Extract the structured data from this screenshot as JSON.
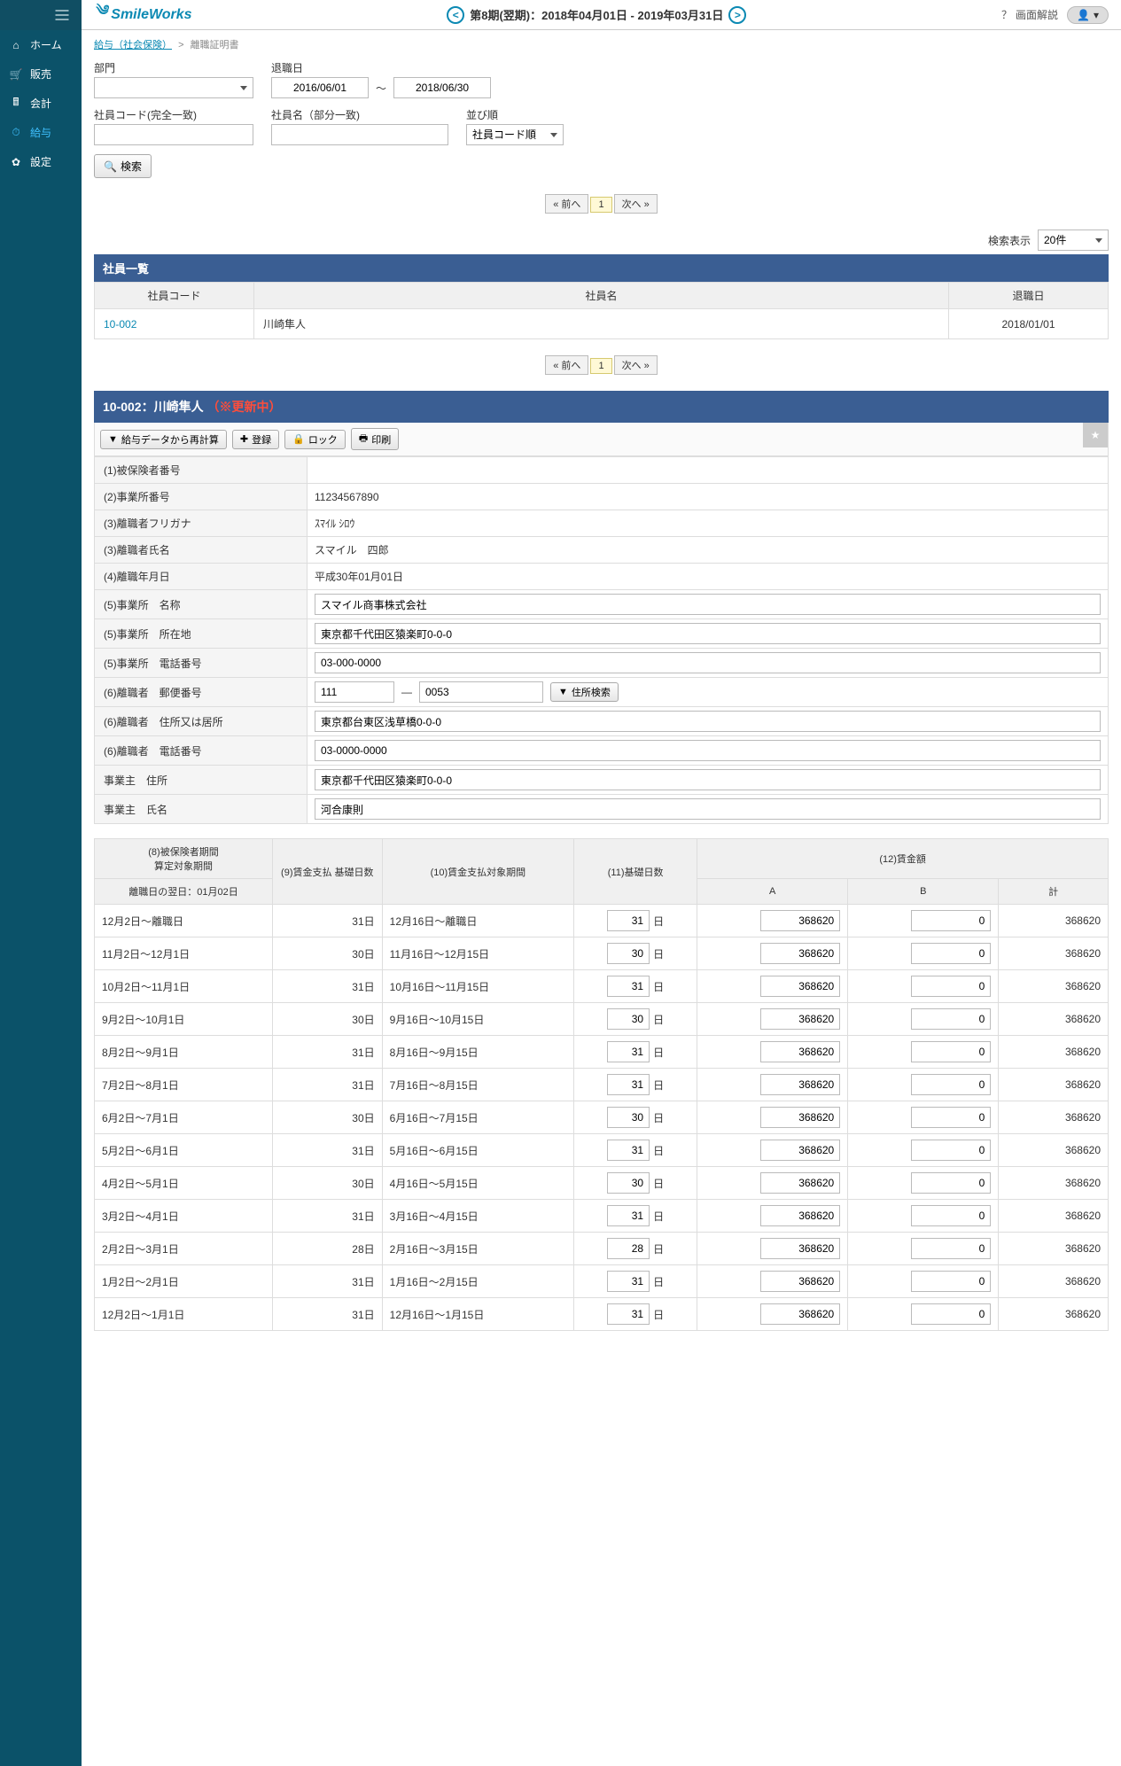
{
  "brand": "SmileWorks",
  "header": {
    "period": "第8期(翌期)：2018年04月01日 - 2019年03月31日",
    "help": "画面解説"
  },
  "sidebar": {
    "items": [
      {
        "label": "ホーム"
      },
      {
        "label": "販売"
      },
      {
        "label": "会計"
      },
      {
        "label": "給与"
      },
      {
        "label": "設定"
      }
    ]
  },
  "breadcrumb": {
    "parent": "給与（社会保険）",
    "current": "離職証明書"
  },
  "search": {
    "dept_label": "部門",
    "leave_label": "退職日",
    "leave_from": "2016/06/01",
    "leave_to": "2018/06/30",
    "tilde": "～",
    "code_label": "社員コード(完全一致)",
    "name_label": "社員名（部分一致)",
    "sort_label": "並び順",
    "sort_value": "社員コード順",
    "search_btn": "検索"
  },
  "pager": {
    "prev": "« 前へ",
    "page": "1",
    "next": "次へ »"
  },
  "results": {
    "display_label": "検索表示",
    "display_value": "20件",
    "title": "社員一覧",
    "cols": {
      "code": "社員コード",
      "name": "社員名",
      "leave": "退職日"
    },
    "rows": [
      {
        "code": "10-002",
        "name": "川崎隼人",
        "leave": "2018/01/01"
      }
    ]
  },
  "detail": {
    "title_id": "10-002：川崎隼人",
    "title_warn": "（※更新中）",
    "btn_recalc": "給与データから再計算",
    "btn_reg": "登録",
    "btn_lock": "ロック",
    "btn_print": "印刷",
    "fields": {
      "f1": {
        "label": "(1)被保険者番号",
        "value": ""
      },
      "f2": {
        "label": "(2)事業所番号",
        "value": "11234567890"
      },
      "f3a": {
        "label": "(3)離職者フリガナ",
        "value": "ｽﾏｲﾙ ｼﾛｳ"
      },
      "f3b": {
        "label": "(3)離職者氏名",
        "value": "スマイル　四郎"
      },
      "f4": {
        "label": "(4)離職年月日",
        "value": "平成30年01月01日"
      },
      "f5a": {
        "label": "(5)事業所　名称",
        "value": "スマイル商事株式会社"
      },
      "f5b": {
        "label": "(5)事業所　所在地",
        "value": "東京都千代田区猿楽町0-0-0"
      },
      "f5c": {
        "label": "(5)事業所　電話番号",
        "value": "03-000-0000"
      },
      "f6a": {
        "label": "(6)離職者　郵便番号",
        "zip1": "111",
        "zip2": "0053",
        "addr_btn": "住所検索"
      },
      "f6b": {
        "label": "(6)離職者　住所又は居所",
        "value": "東京都台東区浅草橋0-0-0"
      },
      "f6c": {
        "label": "(6)離職者　電話番号",
        "value": "03-0000-0000"
      },
      "f7a": {
        "label": "事業主　住所",
        "value": "東京都千代田区猿楽町0-0-0"
      },
      "f7b": {
        "label": "事業主　氏名",
        "value": "河合康則"
      }
    }
  },
  "wage": {
    "headers": {
      "h8a": "(8)被保険者期間",
      "h8b": "算定対象期間",
      "h9": "(9)賃金支払\n基礎日数",
      "h10": "(10)賃金支払対象期間",
      "h11": "(11)基礎日数",
      "h12": "(12)賃金額",
      "sub_next": "離職日の翌日：01月02日",
      "a": "A",
      "b": "B",
      "total": "計",
      "day_unit": "日"
    },
    "rows": [
      {
        "p": "12月2日～離職日",
        "d9": "31日",
        "p10": "12月16日～離職日",
        "d11": "31",
        "a": "368620",
        "b": "0",
        "t": "368620"
      },
      {
        "p": "11月2日～12月1日",
        "d9": "30日",
        "p10": "11月16日～12月15日",
        "d11": "30",
        "a": "368620",
        "b": "0",
        "t": "368620"
      },
      {
        "p": "10月2日～11月1日",
        "d9": "31日",
        "p10": "10月16日～11月15日",
        "d11": "31",
        "a": "368620",
        "b": "0",
        "t": "368620"
      },
      {
        "p": "9月2日～10月1日",
        "d9": "30日",
        "p10": "9月16日～10月15日",
        "d11": "30",
        "a": "368620",
        "b": "0",
        "t": "368620"
      },
      {
        "p": "8月2日～9月1日",
        "d9": "31日",
        "p10": "8月16日～9月15日",
        "d11": "31",
        "a": "368620",
        "b": "0",
        "t": "368620"
      },
      {
        "p": "7月2日～8月1日",
        "d9": "31日",
        "p10": "7月16日～8月15日",
        "d11": "31",
        "a": "368620",
        "b": "0",
        "t": "368620"
      },
      {
        "p": "6月2日～7月1日",
        "d9": "30日",
        "p10": "6月16日～7月15日",
        "d11": "30",
        "a": "368620",
        "b": "0",
        "t": "368620"
      },
      {
        "p": "5月2日～6月1日",
        "d9": "31日",
        "p10": "5月16日～6月15日",
        "d11": "31",
        "a": "368620",
        "b": "0",
        "t": "368620"
      },
      {
        "p": "4月2日～5月1日",
        "d9": "30日",
        "p10": "4月16日～5月15日",
        "d11": "30",
        "a": "368620",
        "b": "0",
        "t": "368620"
      },
      {
        "p": "3月2日～4月1日",
        "d9": "31日",
        "p10": "3月16日～4月15日",
        "d11": "31",
        "a": "368620",
        "b": "0",
        "t": "368620"
      },
      {
        "p": "2月2日～3月1日",
        "d9": "28日",
        "p10": "2月16日～3月15日",
        "d11": "28",
        "a": "368620",
        "b": "0",
        "t": "368620"
      },
      {
        "p": "1月2日～2月1日",
        "d9": "31日",
        "p10": "1月16日～2月15日",
        "d11": "31",
        "a": "368620",
        "b": "0",
        "t": "368620"
      },
      {
        "p": "12月2日～1月1日",
        "d9": "31日",
        "p10": "12月16日～1月15日",
        "d11": "31",
        "a": "368620",
        "b": "0",
        "t": "368620"
      }
    ]
  }
}
